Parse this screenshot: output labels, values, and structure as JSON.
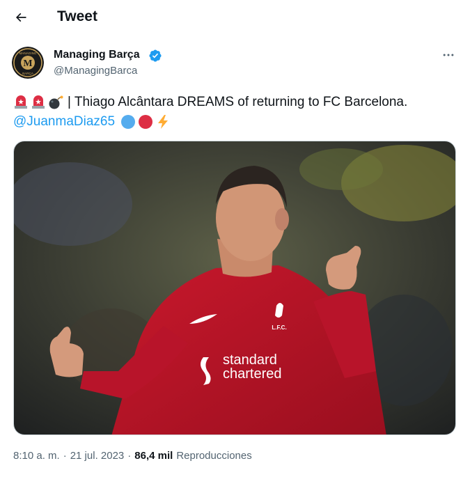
{
  "header": {
    "title": "Tweet",
    "back_icon": "arrow-left-icon"
  },
  "author": {
    "display_name": "Managing Barça",
    "handle": "@ManagingBarca",
    "verified": true,
    "avatar_text_top": "MANAGING",
    "avatar_letter": "M",
    "avatar_text_bottom": "BARÇA"
  },
  "tweet": {
    "leading_emojis": [
      "rotating-light-icon",
      "rotating-light-icon",
      "bomb-icon"
    ],
    "text": "| Thiago Alcântara DREAMS of returning to FC Barcelona.",
    "mention": "@JuanmaDiaz65",
    "trailing_emojis": [
      "blue-circle-icon",
      "red-circle-icon",
      "lightning-icon"
    ]
  },
  "media": {
    "alt": "Thiago Alcântara in a Liverpool jersey",
    "crest_text": "L.F.C.",
    "sponsor_line1": "standard",
    "sponsor_line2": "chartered"
  },
  "meta": {
    "time": "8:10 a. m.",
    "separator": "·",
    "date": "21 jul. 2023",
    "views_count": "86,4 mil",
    "views_label": "Reproducciones"
  },
  "colors": {
    "accent": "#1d9bf0",
    "text": "#0f1419",
    "muted": "#536471",
    "jersey": "#c8102e"
  }
}
